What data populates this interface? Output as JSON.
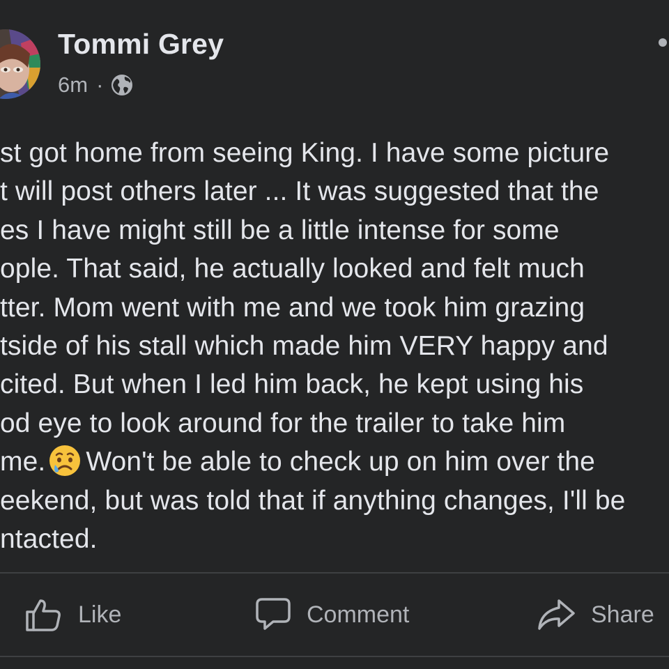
{
  "post": {
    "author": "Tommi Grey",
    "time": "6m",
    "separator": "·",
    "audience_icon": "globe-icon",
    "more_icon": "more-dots-icon",
    "lines": [
      "st got home from seeing King. I have some picture",
      "t will post others later ... It was suggested that the",
      "es I have might still be a little intense for some",
      "ople. That said, he actually looked and felt much",
      "tter. Mom went with me and we took him grazing",
      "tside of his stall which made him VERY happy and",
      "cited. But when I led him back, he kept using his",
      "od eye to look around for the trailer to take him",
      "me.",
      "eekend, but was told that if anything changes, I'll be",
      "ntacted."
    ],
    "line9_after_emoji": "Won't be able to check up on him over the",
    "emoji": "sad-but-relieved-face-emoji"
  },
  "actions": {
    "like": "Like",
    "comment": "Comment",
    "share": "Share"
  },
  "colors": {
    "background": "#242526",
    "primary_text": "#e4e6eb",
    "secondary_text": "#b0b3b8",
    "divider": "#3e4042"
  }
}
